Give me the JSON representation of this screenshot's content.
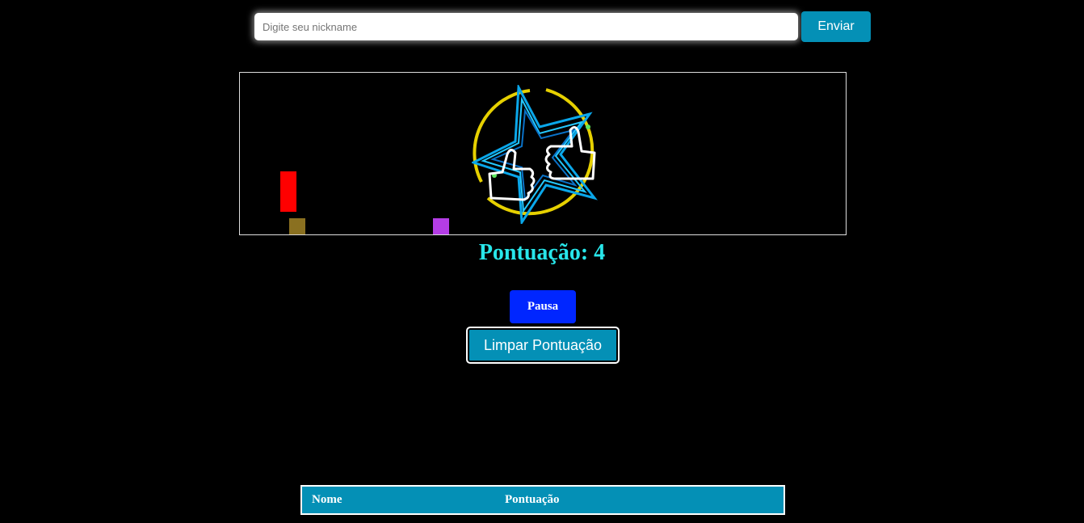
{
  "nickname_form": {
    "placeholder": "Digite seu nickname",
    "value": "",
    "submit_label": "Enviar"
  },
  "game": {
    "logo": "neon-star-thumbs-up-logo",
    "colors": {
      "player": "#ff0000",
      "obstacle_1": "#8a7020",
      "obstacle_2": "#b43de6"
    }
  },
  "score": {
    "text": "Pontuação: 4"
  },
  "controls": {
    "pause_label": "Pausa",
    "clear_label": "Limpar Pontuação"
  },
  "scoreboard": {
    "columns": [
      "Nome",
      "Pontuação"
    ],
    "rows": []
  },
  "colors": {
    "background": "#000000",
    "accent": "#0490b6",
    "pause": "#0026ff",
    "score_text": "#28e6ea"
  }
}
